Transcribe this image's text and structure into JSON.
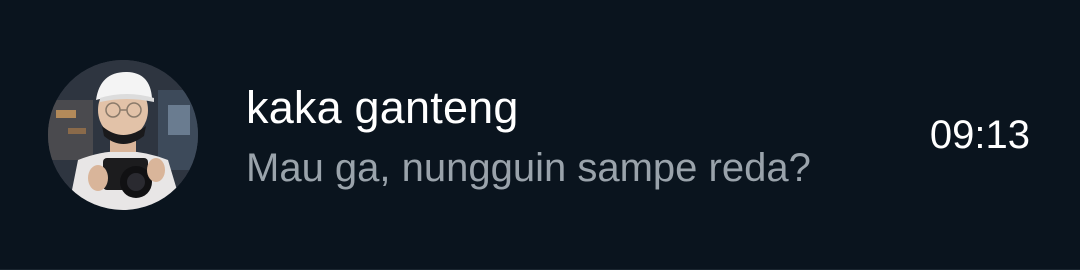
{
  "chat_item": {
    "name": "kaka ganteng",
    "last_message": "Mau ga, nungguin sampe reda?",
    "time": "09:13",
    "avatar_icon": "profile-photo"
  },
  "colors": {
    "background": "#0a141e",
    "name_text": "#ffffff",
    "message_text": "#9aa3ab",
    "time_text": "#ffffff"
  }
}
